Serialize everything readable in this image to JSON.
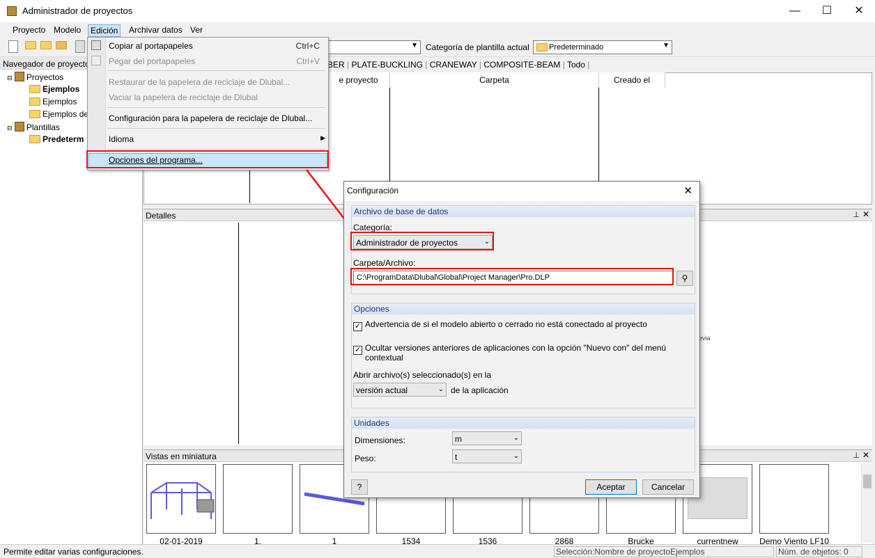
{
  "window": {
    "title": "Administrador de proyectos",
    "minimize": "—",
    "maximize": "☐",
    "close": "✕"
  },
  "menubar": [
    "Proyecto",
    "Modelo",
    "Edición",
    "Archivar datos",
    "Ver"
  ],
  "toolbar": {
    "template_category_label": "Categoría de plantilla actual",
    "template_category_value": "Predeterminado"
  },
  "navigator": {
    "title": "Navegador de proyecto",
    "items": [
      {
        "label": "Proyectos",
        "bold": false
      },
      {
        "label": "Ejemplos",
        "bold": true
      },
      {
        "label": "Ejemplos",
        "bold": false
      },
      {
        "label": "Ejemplos de",
        "bold": false
      },
      {
        "label": "Plantillas",
        "bold": false
      },
      {
        "label": "Predeterm",
        "bold": true
      }
    ]
  },
  "tabs": [
    "BER",
    "PLATE-BUCKLING",
    "CRANEWAY",
    "COMPOSITE-BEAM",
    "Todo"
  ],
  "list_columns": [
    "e proyecto",
    "Carpeta",
    "Creado el"
  ],
  "details_title": "Detalles",
  "details_fragment": "revia",
  "thumbnails_title": "Vistas en miniatura",
  "thumbnails": [
    "02-01-2019",
    "1.",
    "1",
    "1534",
    "1536",
    "2868",
    "Brucke",
    "currentnew",
    "Demo Viento LF10"
  ],
  "status": {
    "left": "Permite editar varias configuraciones.",
    "selection": "Selección:Nombre de proyectoEjemplos",
    "count": "Núm. de objetos: 0"
  },
  "edit_menu": {
    "items": [
      {
        "label": "Copiar al portapapeles",
        "shortcut": "Ctrl+C",
        "disabled": false
      },
      {
        "label": "Pegar del portapapeles",
        "shortcut": "Ctrl+V",
        "disabled": true
      },
      {
        "label": "Restaurar de la papelera de reciclaje de Dlubal...",
        "shortcut": "",
        "disabled": true
      },
      {
        "label": "Vaciar la papelera de reciclaje de Dlubal",
        "shortcut": "",
        "disabled": true
      },
      {
        "label": "Configuración para la papelera de reciclaje de Dlubal...",
        "shortcut": "",
        "disabled": false
      },
      {
        "label": "Idioma",
        "shortcut": "",
        "disabled": false
      },
      {
        "label": "Opciones del programa...",
        "shortcut": "",
        "disabled": false
      }
    ]
  },
  "dialog": {
    "title": "Configuración",
    "db_group": "Archivo de base de datos",
    "category_label": "Categoría:",
    "category_value": "Administrador de proyectos",
    "path_label": "Carpeta/Archivo:",
    "path_value": "C:\\ProgramData\\Dlubal\\Global\\Project Manager\\Pro.DLP",
    "options_group": "Opciones",
    "opt1": "Advertencia de si el modelo abierto o cerrado no está conectado al proyecto",
    "opt2_line1": "Ocultar versiones anteriores de aplicaciones con la opción \"Nuevo con\" del menú",
    "opt2_line2": "contextual",
    "open_label": "Abrir archivo(s) seleccionado(s) en la",
    "open_value": "versión actual",
    "open_suffix": "de la aplicación",
    "units_group": "Unidades",
    "dim_label": "Dimensiones:",
    "dim_value": "m",
    "weight_label": "Peso:",
    "weight_value": "t",
    "ok": "Aceptar",
    "cancel": "Cancelar"
  },
  "colors": {
    "highlight": "#cce4f7",
    "annotation": "#e11111",
    "folder": "#f4d36b"
  }
}
